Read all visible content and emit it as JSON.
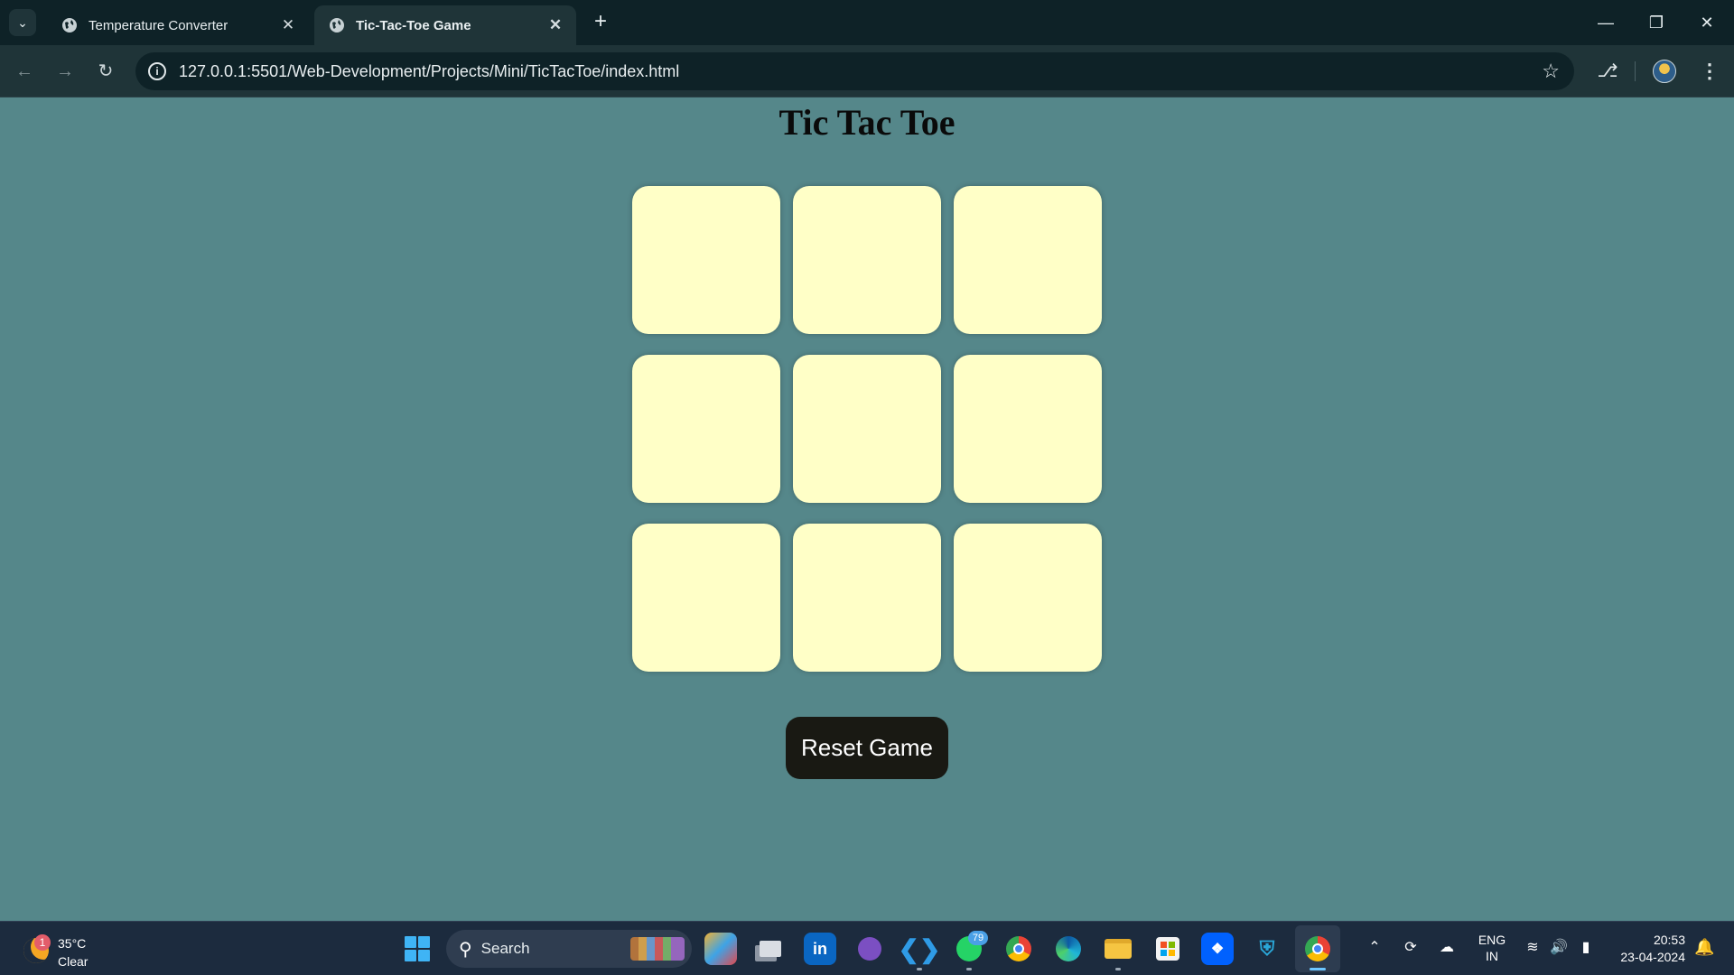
{
  "browser": {
    "tabs": [
      {
        "title": "Temperature Converter",
        "active": false
      },
      {
        "title": "Tic-Tac-Toe Game",
        "active": true
      }
    ],
    "url": "127.0.0.1:5501/Web-Development/Projects/Mini/TicTacToe/index.html"
  },
  "page": {
    "title": "Tic Tac Toe",
    "cells": [
      "",
      "",
      "",
      "",
      "",
      "",
      "",
      "",
      ""
    ],
    "reset_label": "Reset Game",
    "colors": {
      "background": "#55878a",
      "cell": "#ffffc7",
      "button": "#191913"
    }
  },
  "taskbar": {
    "weather": {
      "temp": "35°C",
      "condition": "Clear",
      "badge": "1"
    },
    "search_placeholder": "Search",
    "whatsapp_badge": "79",
    "language": {
      "line1": "ENG",
      "line2": "IN"
    },
    "time": "20:53",
    "date": "23-04-2024"
  }
}
